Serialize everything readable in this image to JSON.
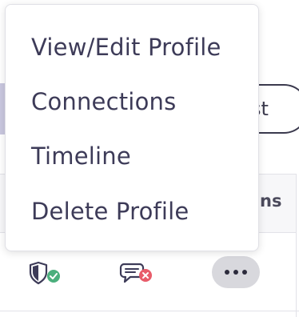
{
  "background": {
    "pill_button_label": "st",
    "table_header_label": "ns"
  },
  "row": {
    "shield_icon": "shield-check-icon",
    "chat_icon": "chat-blocked-icon",
    "more_icon": "more-horizontal-icon"
  },
  "menu": {
    "items": [
      {
        "label": "View/Edit Profile"
      },
      {
        "label": "Connections"
      },
      {
        "label": "Timeline"
      },
      {
        "label": "Delete Profile"
      }
    ]
  },
  "colors": {
    "menu_text": "#3d3b58",
    "success": "#4caf7d",
    "danger": "#e85c6a",
    "more_button_bg": "#d8d8dd"
  }
}
